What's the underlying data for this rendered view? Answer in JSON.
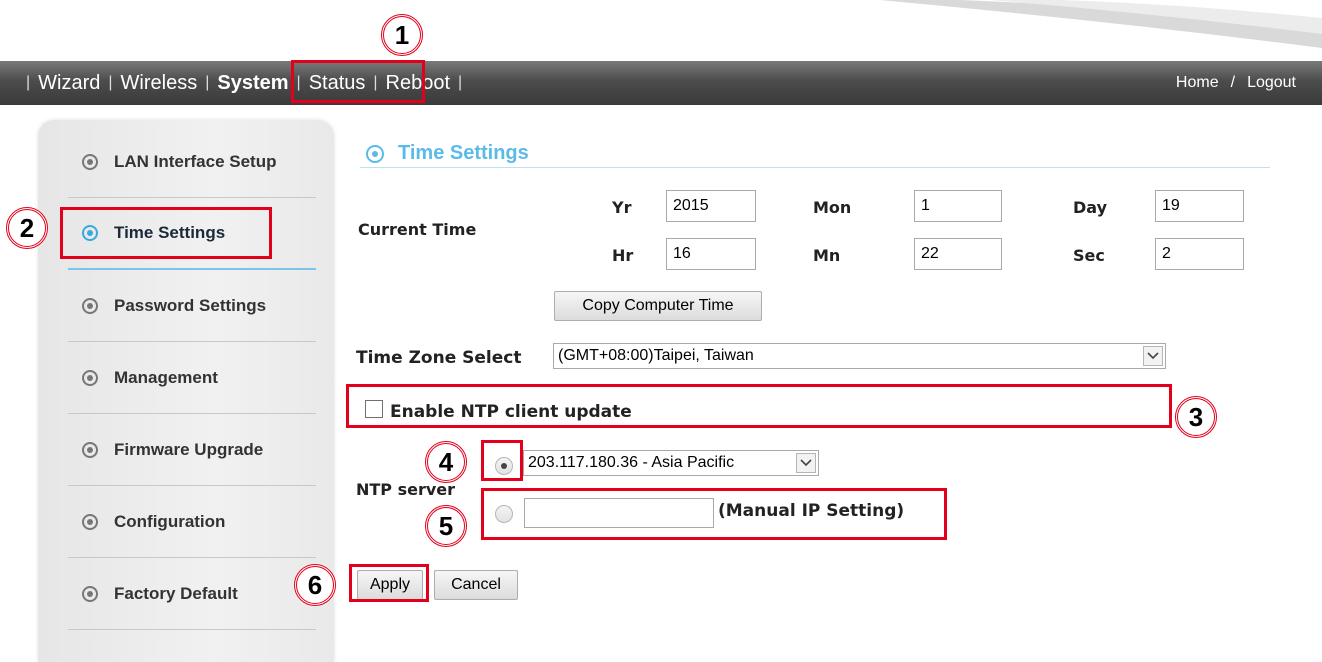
{
  "nav": {
    "items": [
      {
        "label": "Wizard",
        "active": false
      },
      {
        "label": "Wireless",
        "active": false
      },
      {
        "label": "System",
        "active": true
      },
      {
        "label": "Status",
        "active": false
      },
      {
        "label": "Reboot",
        "active": false
      }
    ],
    "home": "Home",
    "separator": "/",
    "logout": "Logout"
  },
  "sidebar": {
    "items": [
      {
        "label": "LAN Interface Setup",
        "active": false
      },
      {
        "label": "Time Settings",
        "active": true
      },
      {
        "label": "Password Settings",
        "active": false
      },
      {
        "label": "Management",
        "active": false
      },
      {
        "label": "Firmware Upgrade",
        "active": false
      },
      {
        "label": "Configuration",
        "active": false
      },
      {
        "label": "Factory Default",
        "active": false
      }
    ]
  },
  "main": {
    "title": "Time Settings",
    "current_time_label": "Current Time",
    "time": {
      "yr_label": "Yr",
      "yr": "2015",
      "mon_label": "Mon",
      "mon": "1",
      "day_label": "Day",
      "day": "19",
      "hr_label": "Hr",
      "hr": "16",
      "mn_label": "Mn",
      "mn": "22",
      "sec_label": "Sec",
      "sec": "2"
    },
    "copy_button": "Copy Computer Time",
    "timezone_label": "Time Zone Select",
    "timezone_value": "(GMT+08:00)Taipei, Taiwan",
    "ntp_enable_label": "Enable NTP client update",
    "ntp_enabled": false,
    "ntp_server_label": "NTP server",
    "ntp_server_value": "203.117.180.36 - Asia Pacific",
    "manual_ip_label": "(Manual IP Setting)",
    "manual_ip_value": "",
    "apply_button": "Apply",
    "cancel_button": "Cancel"
  },
  "annotations": [
    "1",
    "2",
    "3",
    "4",
    "5",
    "6"
  ],
  "colors": {
    "annotation_red": "#e3001b",
    "accent_blue": "#5bbbe8",
    "nav_bar": "#4c4c4c"
  }
}
